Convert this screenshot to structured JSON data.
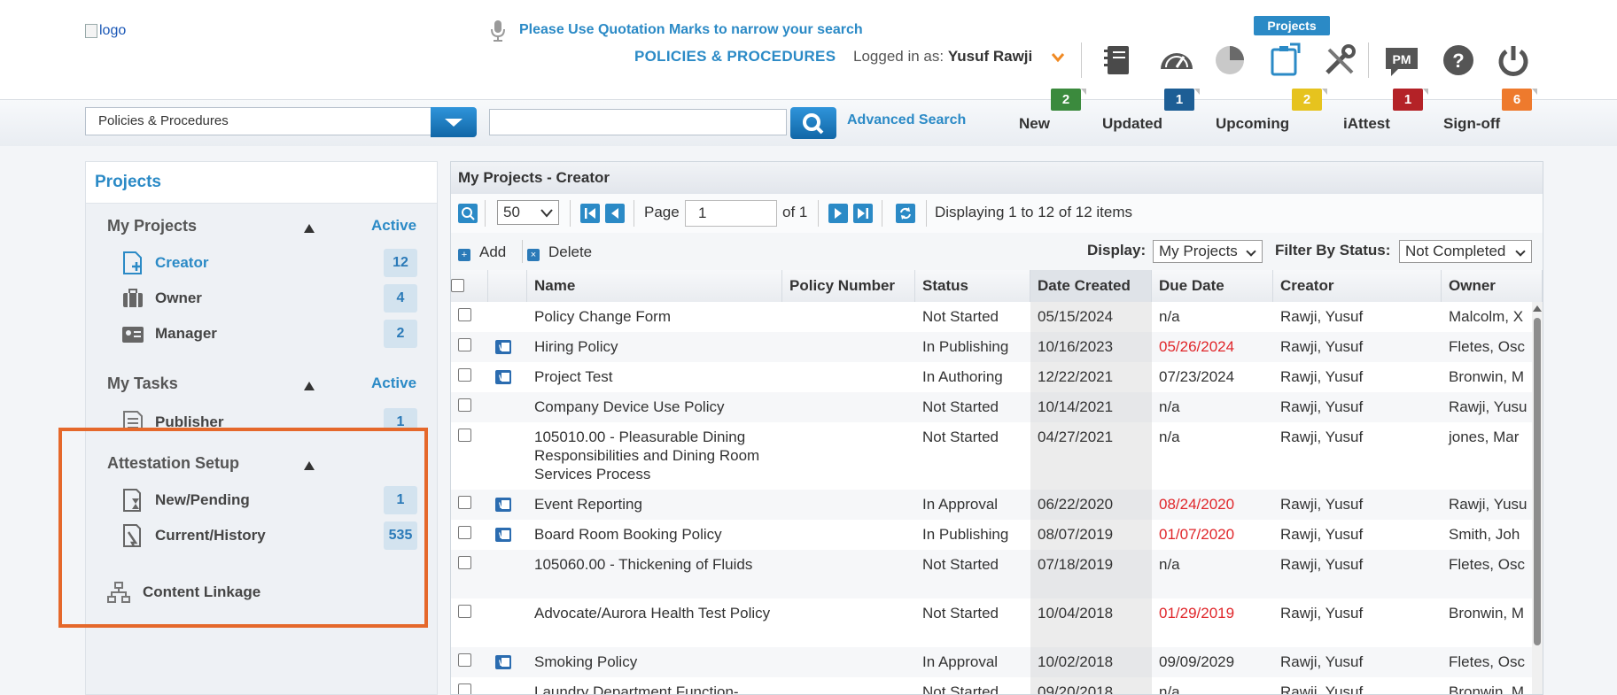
{
  "header": {
    "logo_alt": "logo",
    "search_hint": "Please Use Quotation Marks to narrow your search",
    "module": "POLICIES & PROCEDURES",
    "logged_prefix": "Logged in as:",
    "user": "Yusuf Rawji",
    "projects_badge": "Projects"
  },
  "icons": [
    "notebook-icon",
    "dashboard-icon",
    "pie-chart-icon",
    "projects-icon",
    "tools-icon",
    "pm-icon",
    "help-icon",
    "power-icon"
  ],
  "search": {
    "category": "Policies & Procedures",
    "placeholder": "",
    "advanced": "Advanced Search"
  },
  "stats": [
    {
      "label": "New",
      "count": "2",
      "color": "#3b8a3d"
    },
    {
      "label": "Updated",
      "count": "1",
      "color": "#1d5e95"
    },
    {
      "label": "Upcoming",
      "count": "2",
      "color": "#e6c31e"
    },
    {
      "label": "iAttest",
      "count": "1",
      "color": "#b42227"
    },
    {
      "label": "Sign-off",
      "count": "6",
      "color": "#ee7a2d"
    }
  ],
  "sidebar": {
    "title": "Projects",
    "my_projects": {
      "title": "My Projects",
      "active": "Active",
      "items": [
        {
          "label": "Creator",
          "count": "12"
        },
        {
          "label": "Owner",
          "count": "4"
        },
        {
          "label": "Manager",
          "count": "2"
        }
      ]
    },
    "my_tasks": {
      "title": "My Tasks",
      "active": "Active",
      "items": [
        {
          "label": "Publisher",
          "count": "1"
        }
      ]
    },
    "attestation": {
      "title": "Attestation Setup",
      "items": [
        {
          "label": "New/Pending",
          "count": "1"
        },
        {
          "label": "Current/History",
          "count": "535"
        }
      ]
    },
    "content_linkage": "Content Linkage"
  },
  "grid": {
    "title": "My Projects - Creator",
    "page_size": "50",
    "page_label": "Page",
    "page": "1",
    "of": "of 1",
    "displaying": "Displaying 1 to 12 of 12 items",
    "add": "Add",
    "delete": "Delete",
    "display_label": "Display:",
    "display_value": "My Projects",
    "filter_label": "Filter By Status:",
    "filter_value": "Not Completed",
    "columns": [
      "Name",
      "Policy Number",
      "Status",
      "Date Created",
      "Due Date",
      "Creator",
      "Owner"
    ],
    "rows": [
      {
        "doc": false,
        "name": "Policy Change Form",
        "policy": "",
        "status": "Not Started",
        "created": "05/15/2024",
        "due": "n/a",
        "overdue": false,
        "creator": "Rawji, Yusuf",
        "owner": "Malcolm, X"
      },
      {
        "doc": true,
        "name": "Hiring Policy",
        "policy": "",
        "status": "In Publishing",
        "created": "10/16/2023",
        "due": "05/26/2024",
        "overdue": true,
        "creator": "Rawji, Yusuf",
        "owner": "Fletes, Osc"
      },
      {
        "doc": true,
        "name": "Project Test",
        "policy": "",
        "status": "In Authoring",
        "created": "12/22/2021",
        "due": "07/23/2024",
        "overdue": false,
        "creator": "Rawji, Yusuf",
        "owner": "Bronwin, M"
      },
      {
        "doc": false,
        "name": "Company Device Use Policy",
        "policy": "",
        "status": "Not Started",
        "created": "10/14/2021",
        "due": "n/a",
        "overdue": false,
        "creator": "Rawji, Yusuf",
        "owner": "Rawji, Yusu"
      },
      {
        "doc": false,
        "name": "105010.00 - Pleasurable Dining Responsibilities and Dining Room Services Process",
        "policy": "",
        "status": "Not Started",
        "created": "04/27/2021",
        "due": "n/a",
        "overdue": false,
        "creator": "Rawji, Yusuf",
        "owner": "jones, Mar"
      },
      {
        "doc": true,
        "name": "Event Reporting",
        "policy": "",
        "status": "In Approval",
        "created": "06/22/2020",
        "due": "08/24/2020",
        "overdue": true,
        "creator": "Rawji, Yusuf",
        "owner": "Rawji, Yusu"
      },
      {
        "doc": true,
        "name": "Board Room Booking Policy",
        "policy": "",
        "status": "In Publishing",
        "created": "08/07/2019",
        "due": "01/07/2020",
        "overdue": true,
        "creator": "Rawji, Yusuf",
        "owner": "Smith, Joh"
      },
      {
        "doc": false,
        "name": "105060.00 - Thickening of Fluids",
        "policy": "",
        "status": "Not Started",
        "created": "07/18/2019",
        "due": "n/a",
        "overdue": false,
        "creator": "Rawji, Yusuf",
        "owner": "Fletes, Osc"
      },
      {
        "doc": false,
        "name": "Advocate/Aurora Health Test Policy",
        "policy": "",
        "status": "Not Started",
        "created": "10/04/2018",
        "due": "01/29/2019",
        "overdue": true,
        "creator": "Rawji, Yusuf",
        "owner": "Bronwin, M"
      },
      {
        "doc": true,
        "name": "Smoking Policy",
        "policy": "",
        "status": "In Approval",
        "created": "10/02/2018",
        "due": "09/09/2029",
        "overdue": false,
        "creator": "Rawji, Yusuf",
        "owner": "Fletes, Osc"
      },
      {
        "doc": false,
        "name": "Laundry Department Function-",
        "policy": "",
        "status": "Not Started",
        "created": "09/20/2018",
        "due": "n/a",
        "overdue": false,
        "creator": "Rawji, Yusuf",
        "owner": "Bronwin, M"
      }
    ]
  }
}
